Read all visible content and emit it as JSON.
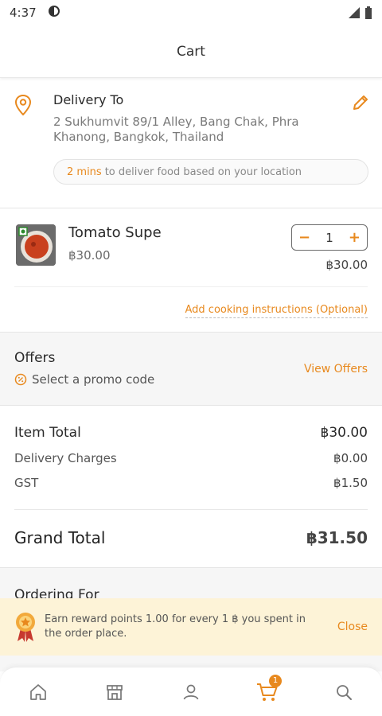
{
  "status_bar": {
    "time": "4:37"
  },
  "header": {
    "title": "Cart"
  },
  "delivery": {
    "title": "Delivery To",
    "address": "2 Sukhumvit 89/1 Alley, Bang Chak, Phra Khanong, Bangkok, Thailand",
    "eta_highlight": "2 mins",
    "eta_text": "to deliver food based on your location"
  },
  "cart_item": {
    "name": "Tomato Supe",
    "price": "฿30.00",
    "quantity": "1",
    "decrement_label": "−",
    "increment_label": "+",
    "line_total": "฿30.00",
    "instructions_link": "Add cooking instructions (Optional)"
  },
  "offers": {
    "title": "Offers",
    "promo_text": "Select a promo code",
    "view_offers": "View Offers"
  },
  "totals": {
    "item_total_label": "Item Total",
    "item_total_value": "฿30.00",
    "delivery_label": "Delivery Charges",
    "delivery_value": "฿0.00",
    "gst_label": "GST",
    "gst_value": "฿1.50",
    "grand_label": "Grand Total",
    "grand_value": "฿31.50"
  },
  "ordering": {
    "title": "Ordering For"
  },
  "reward": {
    "text": "Earn reward points 1.00 for every 1 ฿ you spent in the order place.",
    "close": "Close"
  },
  "bottom_nav": {
    "items": [
      {
        "icon": "home-icon"
      },
      {
        "icon": "store-icon"
      },
      {
        "icon": "profile-icon"
      },
      {
        "icon": "cart-icon",
        "badge": "1"
      },
      {
        "icon": "search-icon"
      }
    ]
  },
  "colors": {
    "accent": "#e8891e",
    "banner": "#fdf3d7",
    "section_bg": "#f6f6f6"
  }
}
